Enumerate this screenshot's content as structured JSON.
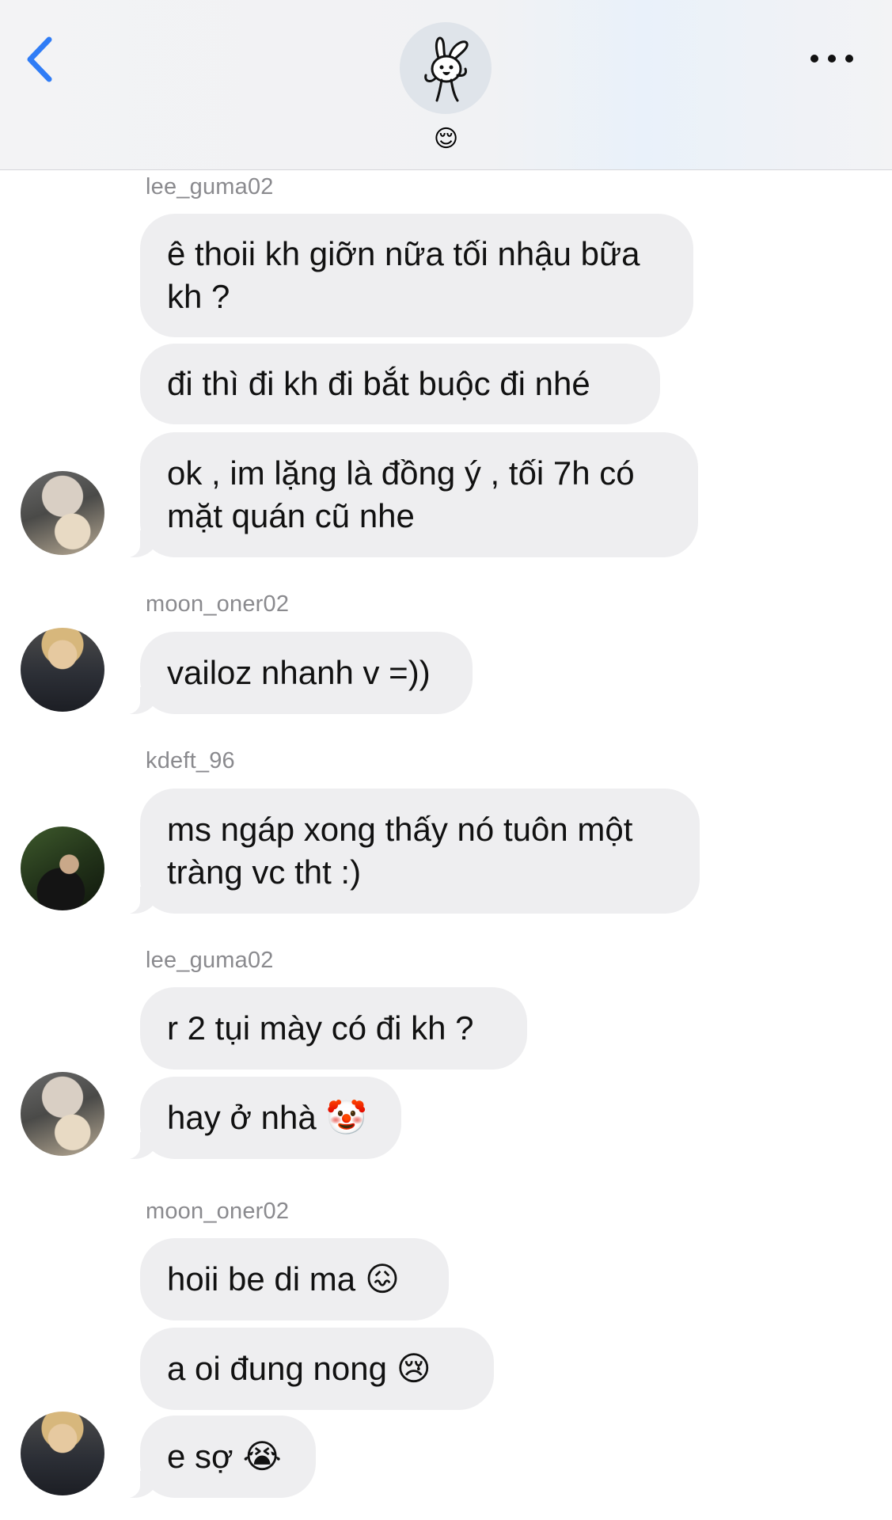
{
  "header": {
    "back_icon": "chevron-left-icon",
    "group_avatar_icon": "bunny-sticker-icon",
    "group_name": "😌",
    "more_icon": "ellipsis-icon",
    "accent_color": "#2f7cf6"
  },
  "chat": {
    "groups": [
      {
        "sender": "lee_guma02",
        "avatar": "lee-guma02-avatar",
        "messages": [
          {
            "text": "ê thoii kh giỡn nữa tối nhậu bữa\nkh ?"
          },
          {
            "text": "đi thì đi kh đi bắt buộc đi nhé"
          },
          {
            "text": "ok , im lặng là đồng ý , tối 7h có\nmặt quán cũ nhe"
          }
        ]
      },
      {
        "sender": "moon_oner02",
        "avatar": "moon-oner02-avatar",
        "messages": [
          {
            "text": "vailoz nhanh v =))"
          }
        ]
      },
      {
        "sender": "kdeft_96",
        "avatar": "kdeft-96-avatar",
        "messages": [
          {
            "text": "ms ngáp xong thấy nó tuôn một\ntràng vc tht :)"
          }
        ]
      },
      {
        "sender": "lee_guma02",
        "avatar": "lee-guma02-avatar",
        "messages": [
          {
            "text": "r 2 tụi mày có đi kh ?"
          },
          {
            "text": "hay ở nhà",
            "emoji": "🤡",
            "emoji_icon": "clown-face-icon"
          }
        ]
      },
      {
        "sender": "moon_oner02",
        "avatar": "moon-oner02-avatar",
        "messages": [
          {
            "text": "hoii be di ma",
            "emoji": "😖",
            "emoji_icon": "confounded-face-icon"
          },
          {
            "text": "a oi đung nong",
            "emoji": "😢",
            "emoji_icon": "crying-face-icon"
          },
          {
            "text": "e sợ",
            "emoji": "😭",
            "emoji_icon": "loudly-crying-face-icon"
          }
        ]
      }
    ]
  }
}
